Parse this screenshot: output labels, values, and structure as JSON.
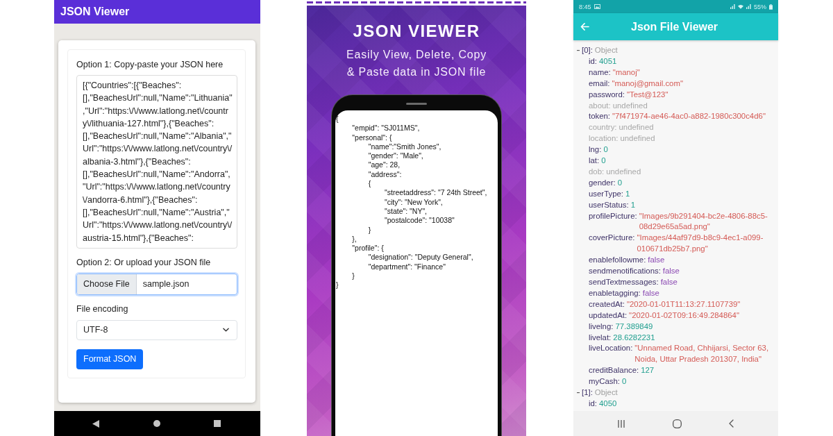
{
  "left_screen": {
    "app_bar": {
      "title": "JSON Viewer"
    },
    "form": {
      "paste_label": "Option 1: Copy-paste your JSON here",
      "json_input": {
        "value": "[{\"Countries\":[{\"Beaches\":[],\"BeachesUrl\":null,\"Name\":\"Lithuania\",\"Url\":\"https:\\/\\/www.latlong.net\\/country\\/lithuania-127.html\"},{\"Beaches\":[],\"BeachesUrl\":null,\"Name\":\"Albania\",\"Url\":\"https:\\/\\/www.latlong.net\\/country\\/albania-3.html\"},{\"Beaches\":[],\"BeachesUrl\":null,\"Name\":\"Andorra\",\"Url\":\"https:\\/\\/www.latlong.net\\/country\\/andorra-6.html\"},{\"Beaches\":[],\"BeachesUrl\":null,\"Name\":\"Austria\",\"Url\":\"https:\\/\\/www.latlong.net\\/country\\/austria-15.html\"},{\"Beaches\":"
      },
      "upload_label": "Option 2: Or upload your JSON file",
      "file_input": {
        "button": "Choose File",
        "file_name": "sample.json",
        "focused": true
      },
      "encoding_label": "File encoding",
      "encoding_select": {
        "value": "UTF-8"
      },
      "submit_button": "Format JSON"
    }
  },
  "promo": {
    "title": "JSON VIEWER",
    "subtitle": "Easily View, Delete, Copy & Paste data in JSON file",
    "code_sample": "{\n        \"empid\": \"SJ011MS\",\n        \"personal\": {\n                \"name\":\"Smith Jones\",\n                \"gender\": \"Male\",\n                \"age\": 28,\n                \"address\":\n                {\n                        \"streetaddress\": \"7 24th Street\",\n                        \"city\": \"New York\",\n                        \"state\": \"NY\",\n                        \"postalcode\": \"10038\"\n                }\n        },\n        \"profile\": {\n                \"designation\": \"Deputy General\",\n                \"department\": \"Finance\"\n        }\n}"
  },
  "right_screen": {
    "status_bar": {
      "time": "8:45",
      "battery": "55%"
    },
    "app_bar": {
      "title": "Json File Viewer"
    },
    "tree": [
      {
        "key": "[0]:",
        "type": "Object",
        "expanded": true,
        "children": [
          {
            "kind": "number",
            "key": "id:",
            "value": "4051"
          },
          {
            "kind": "string",
            "key": "name:",
            "value": "\"manoj\""
          },
          {
            "kind": "string",
            "key": "email:",
            "value": "\"manoj@gmail.com\""
          },
          {
            "kind": "string",
            "key": "password:",
            "value": "\"Test@123\""
          },
          {
            "kind": "undefined",
            "key": "about:",
            "value": "undefined"
          },
          {
            "kind": "string",
            "key": "token:",
            "value": "\"7f471974-ae46-4ac0-a882-1980c300c4d6\""
          },
          {
            "kind": "undefined",
            "key": "country:",
            "value": "undefined"
          },
          {
            "kind": "undefined",
            "key": "location:",
            "value": "undefined"
          },
          {
            "kind": "number",
            "key": "lng:",
            "value": "0"
          },
          {
            "kind": "number",
            "key": "lat:",
            "value": "0"
          },
          {
            "kind": "undefined",
            "key": "dob:",
            "value": "undefined"
          },
          {
            "kind": "number",
            "key": "gender:",
            "value": "0"
          },
          {
            "kind": "number",
            "key": "userType:",
            "value": "1"
          },
          {
            "kind": "number",
            "key": "userStatus:",
            "value": "1"
          },
          {
            "kind": "string",
            "key": "profilePicture:",
            "value": "\"Images/9b291404-bc2e-4806-88c5-08d29e65a5ad.png\""
          },
          {
            "kind": "string",
            "key": "coverPicture:",
            "value": "\"Images/44af97d9-b8c9-4ec1-a099-010671db25b7.png\""
          },
          {
            "kind": "boolean",
            "key": "enablefollowme:",
            "value": "false"
          },
          {
            "kind": "boolean",
            "key": "sendmenotifications:",
            "value": "false"
          },
          {
            "kind": "boolean",
            "key": "sendTextmessages:",
            "value": "false"
          },
          {
            "kind": "boolean",
            "key": "enabletagging:",
            "value": "false"
          },
          {
            "kind": "string",
            "key": "createdAt:",
            "value": "\"2020-01-01T11:13:27.1107739\""
          },
          {
            "kind": "string",
            "key": "updatedAt:",
            "value": "\"2020-01-02T09:16:49.284864\""
          },
          {
            "kind": "number",
            "key": "livelng:",
            "value": "77.389849"
          },
          {
            "kind": "number",
            "key": "livelat:",
            "value": "28.6282231"
          },
          {
            "kind": "string",
            "key": "liveLocation:",
            "value": "\"Unnamed Road, Chhijarsi, Sector 63, Noida, Uttar Pradesh 201307, India\""
          },
          {
            "kind": "number",
            "key": "creditBalance:",
            "value": "127"
          },
          {
            "kind": "number",
            "key": "myCash:",
            "value": "0"
          }
        ]
      },
      {
        "key": "[1]:",
        "type": "Object",
        "expanded": true,
        "children": [
          {
            "kind": "number",
            "key": "id:",
            "value": "4050"
          }
        ]
      }
    ]
  }
}
